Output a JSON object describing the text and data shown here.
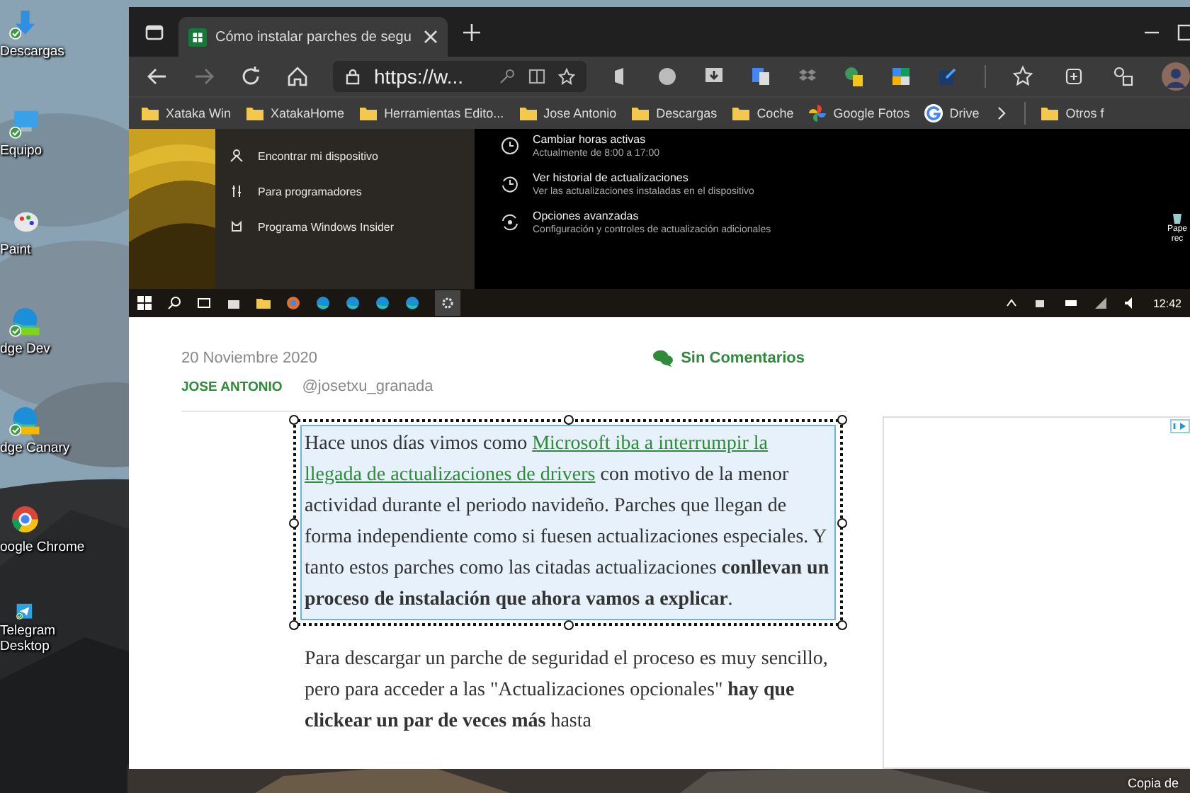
{
  "desktop": {
    "icons": [
      {
        "label": "Descargas",
        "kind": "download",
        "synced": true
      },
      {
        "label": "Equipo",
        "kind": "computer",
        "synced": true
      },
      {
        "label": "Paint",
        "kind": "paint",
        "synced": false
      },
      {
        "label": "dge Dev",
        "kind": "edge-dev",
        "synced": true
      },
      {
        "label": "dge Canary",
        "kind": "edge-canary",
        "synced": true
      },
      {
        "label": "oogle Chrome",
        "kind": "chrome",
        "synced": false
      },
      {
        "label": "Telegram Desktop",
        "kind": "telegram",
        "synced": true
      }
    ],
    "corner_text": "Copia de"
  },
  "browser": {
    "tab": {
      "title": "Cómo instalar parches de segu",
      "selected": true
    },
    "address": "https://w...",
    "bookmarks": [
      {
        "label": "Xataka Win",
        "kind": "folder"
      },
      {
        "label": "XatakaHome",
        "kind": "folder"
      },
      {
        "label": "Herramientas Edito...",
        "kind": "folder"
      },
      {
        "label": "Jose Antonio",
        "kind": "folder"
      },
      {
        "label": "Descargas",
        "kind": "folder"
      },
      {
        "label": "Coche",
        "kind": "folder"
      },
      {
        "label": "Google Fotos",
        "kind": "photos"
      },
      {
        "label": "Drive",
        "kind": "google"
      }
    ],
    "other_bookmarks": "Otros f"
  },
  "embedded_screenshot": {
    "nav_items": [
      {
        "label": "Encontrar mi dispositivo",
        "kind": "person"
      },
      {
        "label": "Para programadores",
        "kind": "tools"
      },
      {
        "label": "Programa Windows Insider",
        "kind": "cat"
      }
    ],
    "options": [
      {
        "title": "Cambiar horas activas",
        "subtitle": "Actualmente de 8:00 a 17:00",
        "kind": "clock"
      },
      {
        "title": "Ver historial de actualizaciones",
        "subtitle": "Ver las actualizaciones instaladas en el dispositivo",
        "kind": "history"
      },
      {
        "title": "Opciones avanzadas",
        "subtitle": "Configuración y controles de actualización adicionales",
        "kind": "sync"
      }
    ],
    "desktop_label": [
      "Pape",
      "rec"
    ],
    "clock": "12:42"
  },
  "article": {
    "date": "20 Noviembre 2020",
    "author": "JOSE ANTONIO",
    "handle": "@josetxu_granada",
    "comments": "Sin Comentarios",
    "paragraphs": [
      {
        "selected": true,
        "segments": [
          {
            "kind": "text",
            "text": "Hace unos días vimos como "
          },
          {
            "kind": "link",
            "text": "Microsoft iba a interrumpir la"
          },
          {
            "kind": "link",
            "text": "llegada de actualizaciones de drivers"
          },
          {
            "kind": "text",
            "text": " con motivo de la menor actividad durante el periodo navideño. Parches que llegan de forma independiente como si fuesen actualizaciones especiales. Y tanto estos parches como las citadas actualizaciones **conllevan un proceso de instalación que ahora vamos a explicar**."
          }
        ]
      },
      {
        "selected": false,
        "segments": [
          {
            "kind": "text",
            "text": "Para descargar un parche de seguridad el proceso es muy sencillo, pero para acceder a las \"Actualizaciones opcionales\" **hay que clickear un par de veces más** hasta"
          }
        ]
      }
    ]
  }
}
